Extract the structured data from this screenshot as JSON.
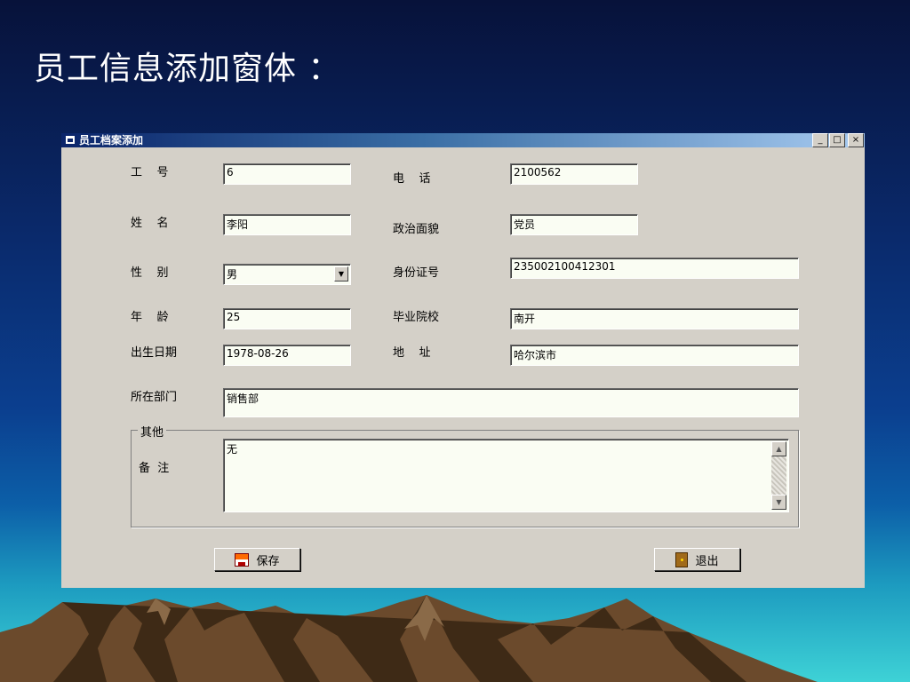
{
  "slide": {
    "title": "员工信息添加窗体 ："
  },
  "window": {
    "title": "员工档案添加",
    "controls": {
      "minimize": "_",
      "maximize": "□",
      "close": "×"
    }
  },
  "form": {
    "employee_id": {
      "label": "工    号",
      "value": "6"
    },
    "phone": {
      "label": "电    话",
      "value": "2100562"
    },
    "name": {
      "label": "姓    名",
      "value": "李阳"
    },
    "political": {
      "label": "政治面貌",
      "value": "党员"
    },
    "gender": {
      "label": "性    别",
      "value": "男"
    },
    "id_card": {
      "label": "身份证号",
      "value": "235002100412301"
    },
    "age": {
      "label": "年    龄",
      "value": "25"
    },
    "school": {
      "label": "毕业院校",
      "value": "南开"
    },
    "birth_date": {
      "label": "出生日期",
      "value": "1978-08-26"
    },
    "address": {
      "label": "地    址",
      "value": "哈尔滨市"
    },
    "department": {
      "label": "所在部门",
      "value": "销售部"
    },
    "other_group": {
      "legend": "其他"
    },
    "remarks": {
      "label": "备  注",
      "value": "无"
    }
  },
  "buttons": {
    "save": "保存",
    "exit": "退出"
  },
  "colors": {
    "title_bar_start": "#0a246a",
    "title_bar_end": "#a6caf0",
    "window_bg": "#d4d0c8",
    "field_bg": "#fafdf3"
  },
  "icons": {
    "window": "app-window-icon",
    "combo": "chevron-down-icon",
    "save": "save-icon",
    "exit": "door-exit-icon"
  }
}
